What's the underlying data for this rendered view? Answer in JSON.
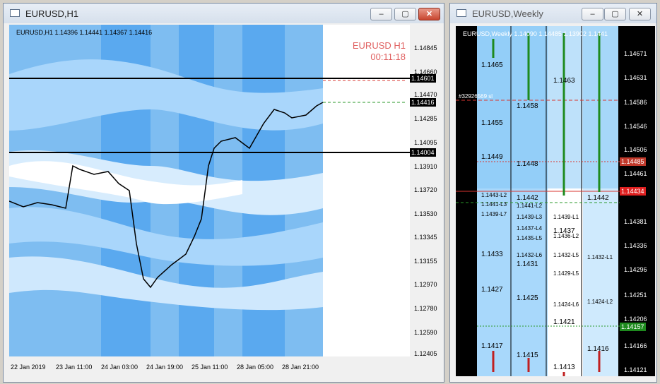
{
  "left_window": {
    "title": "EURUSD,H1",
    "buttons": [
      "minimize",
      "restore",
      "close"
    ],
    "header": "EURUSD,H1  1.14396 1.14441 1.14367 1.14416",
    "overlay_symbol": "EURUSD  H1",
    "overlay_timer": "00:11:18",
    "price_ticks": [
      "1.14845",
      "1.14660",
      "1.14601",
      "1.14470",
      "1.14416",
      "1.14285",
      "1.14095",
      "1.14004",
      "1.13910",
      "1.13720",
      "1.13530",
      "1.13345",
      "1.13155",
      "1.12970",
      "1.12780",
      "1.12590",
      "1.12405"
    ],
    "time_ticks": [
      "22 Jan 2019",
      "23 Jan 11:00",
      "24 Jan 03:00",
      "24 Jan 19:00",
      "25 Jan 11:00",
      "28 Jan 05:00",
      "28 Jan 21:00"
    ],
    "levels": {
      "upper": "1.14601",
      "lower": "1.14004",
      "current": "1.14416"
    }
  },
  "right_window": {
    "title": "EURUSD,Weekly",
    "buttons": [
      "minimize",
      "restore",
      "close"
    ],
    "header": "EURUSD,Weekly  1.14090 1.14485 1.13902 1.1441",
    "order_label": "#32926569 sl",
    "price_ticks": [
      "1.14671",
      "1.14631",
      "1.14586",
      "1.14546",
      "1.14506",
      "1.14485",
      "1.14461",
      "1.14434",
      "1.14381",
      "1.14336",
      "1.14296",
      "1.14251",
      "1.14206",
      "1.14157",
      "1.14166",
      "1.14121"
    ],
    "highlight_ticks": {
      "red1": "1.14485",
      "red2": "1.14434",
      "green": "1.14157"
    },
    "col1": [
      "1.1465",
      "1.1455",
      "1.1449",
      "1.1443-L2",
      "1.1441-L3",
      "1.1439-L7",
      "1.1433",
      "1.1427",
      "1.1417"
    ],
    "col2": [
      "1.1463",
      "1.1458",
      "1.1448",
      "1.1442",
      "1.1441-L2",
      "1.1439-L3",
      "1.1437-L4",
      "1.1435-L5",
      "1.1432-L6",
      "1.1431",
      "1.1425",
      "1.1415"
    ],
    "col3": [
      "1.1439-L1",
      "1.1437",
      "1.1436-L2",
      "1.1432-L5",
      "1.1429-L5",
      "1.1424-L6",
      "1.1421",
      "1.1413"
    ],
    "col4": [
      "1.1442",
      "1.1432-L1",
      "1.1424-L2",
      "1.1416"
    ]
  }
}
